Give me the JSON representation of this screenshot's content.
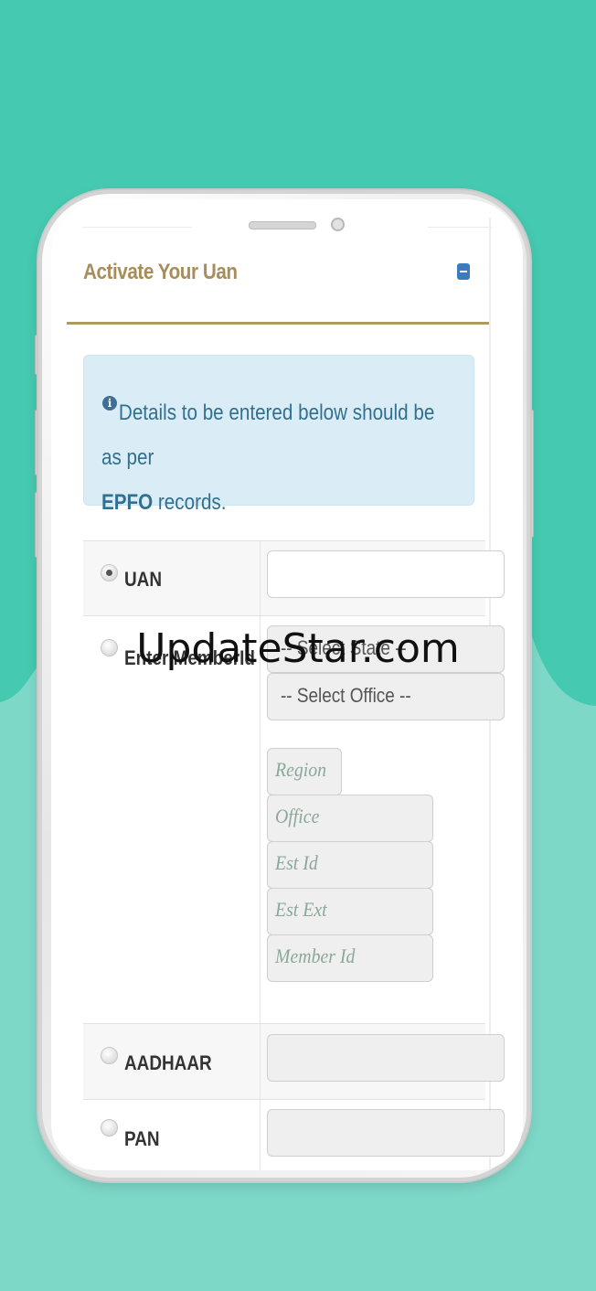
{
  "colors": {
    "teal_top": "#45c9b0",
    "teal_bottom": "#7dd8c8",
    "gold": "#a78d5a",
    "alert_bg": "#daedf7",
    "alert_text": "#31708f",
    "collapse_btn": "#3c7bbd"
  },
  "panel": {
    "title": "Activate Your Uan",
    "collapse_icon": "minus-square-icon"
  },
  "alert": {
    "icon": "info-circle-icon",
    "text_before": "Details to be entered below should be as per",
    "text_bold": "EPFO",
    "text_after": " records."
  },
  "form": {
    "options": [
      {
        "label": "UAN",
        "selected": true
      },
      {
        "label": "Enter MemberId",
        "selected": false
      },
      {
        "label": "AADHAAR",
        "selected": false
      },
      {
        "label": "PAN",
        "selected": false
      }
    ],
    "member_id": {
      "state_select": "-- Select State --",
      "office_select": "-- Select Office --",
      "placeholders": {
        "region": "Region",
        "office": "Office",
        "est_id": "Est Id",
        "est_ext": "Est Ext",
        "member_id": "Member Id"
      }
    }
  },
  "watermark": "UpdateStar.com"
}
